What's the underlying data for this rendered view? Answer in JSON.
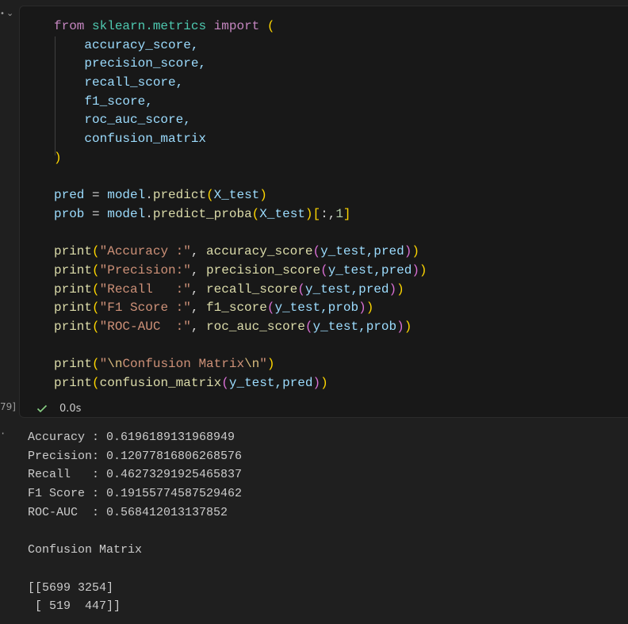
{
  "gutter": {
    "collapse_marker": "•",
    "chevron": "⌄",
    "execution_count": "79]",
    "output_marker": "·"
  },
  "cell": {
    "status_icon": "check-icon",
    "duration": "0.0s",
    "code": {
      "l1": [
        "from",
        " ",
        "sklearn.metrics",
        " ",
        "import",
        " ",
        "("
      ],
      "imports": [
        "accuracy_score,",
        "precision_score,",
        "recall_score,",
        "f1_score,",
        "roc_auc_score,",
        "confusion_matrix"
      ],
      "close_paren": ")",
      "l9": [
        "pred",
        " = ",
        "model",
        ".",
        "predict",
        "(",
        "X_test",
        ")"
      ],
      "l10": [
        "prob",
        " = ",
        "model",
        ".",
        "predict_proba",
        "(",
        "X_test",
        ")",
        "[",
        ":,",
        "1",
        "]"
      ],
      "prints": [
        {
          "fn": "print",
          "str": "\"Accuracy :\"",
          "inner": "accuracy_score",
          "args": "y_test,pred"
        },
        {
          "fn": "print",
          "str": "\"Precision:\"",
          "inner": "precision_score",
          "args": "y_test,pred"
        },
        {
          "fn": "print",
          "str": "\"Recall   :\"",
          "inner": "recall_score",
          "args": "y_test,pred"
        },
        {
          "fn": "print",
          "str": "\"F1 Score :\"",
          "inner": "f1_score",
          "args": "y_test,prob"
        },
        {
          "fn": "print",
          "str": "\"ROC-AUC  :\"",
          "inner": "roc_auc_score",
          "args": "y_test,prob"
        }
      ],
      "l17": {
        "fn": "print",
        "q1": "\"",
        "esc1": "\\n",
        "text": "Confusion Matrix",
        "esc2": "\\n",
        "q2": "\""
      },
      "l18": {
        "fn": "print",
        "inner": "confusion_matrix",
        "args": "y_test,pred"
      }
    }
  },
  "output": {
    "lines": [
      "Accuracy : 0.6196189131968949",
      "Precision: 0.12077816806268576",
      "Recall   : 0.46273291925465837",
      "F1 Score : 0.19155774587529462",
      "ROC-AUC  : 0.568412013137852",
      "",
      "Confusion Matrix",
      "",
      "[[5699 3254]",
      " [ 519  447]]"
    ]
  }
}
